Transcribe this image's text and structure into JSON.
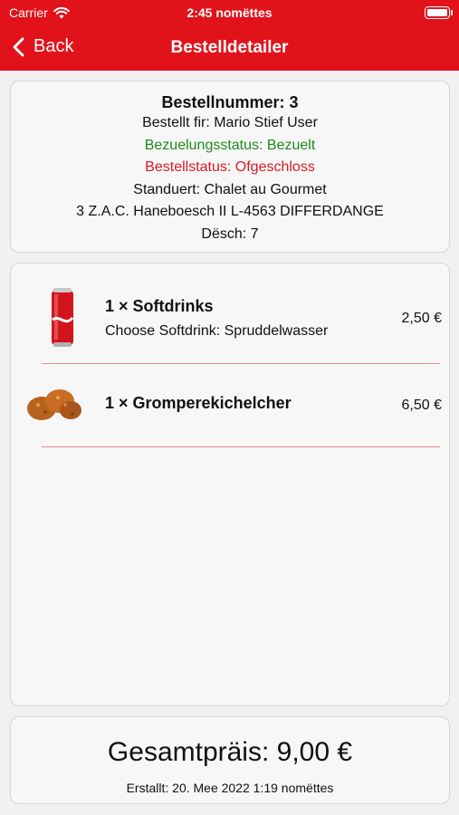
{
  "status_bar": {
    "carrier": "Carrier",
    "time": "2:45 nomëttes"
  },
  "nav": {
    "back_label": "Back",
    "title": "Bestelldetailer"
  },
  "order": {
    "number": "Bestellnummer: 3",
    "ordered_for": "Bestellt fir: Mario Stief User",
    "payment_status": "Bezuelungsstatus: Bezuelt",
    "order_status": "Bestellstatus: Ofgeschloss",
    "location": "Standuert: Chalet au Gourmet",
    "address": "3 Z.A.C. Haneboesch II L-4563 DIFFERDANGE",
    "table": "Dësch: 7"
  },
  "items": [
    {
      "title": "1 × Softdrinks",
      "option": "Choose Softdrink: Spruddelwasser",
      "price": "2,50 €",
      "icon": "cola-can-icon"
    },
    {
      "title": "1 × Gromperekichelcher",
      "price": "6,50 €",
      "icon": "potato-fritters-icon"
    }
  ],
  "summary": {
    "total": "Gesamtpräis: 9,00 €",
    "created": "Erstallt: 20. Mee 2022 1:19 nomëttes"
  },
  "colors": {
    "accent": "#e2121b",
    "paid": "#1f8a1f",
    "status": "#d81b23"
  }
}
